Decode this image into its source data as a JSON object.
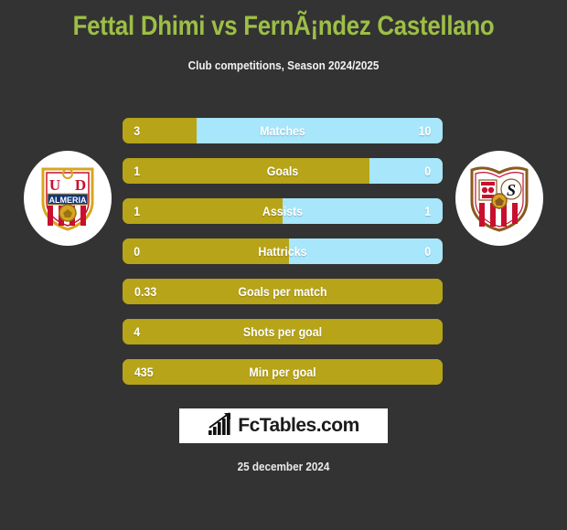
{
  "header": {
    "title": "Fettal Dhimi vs FernÃ¡ndez Castellano",
    "subtitle": "Club competitions, Season 2024/2025"
  },
  "teams": {
    "home": {
      "crest_name": "ud-almeria-crest",
      "crest_text": "UD ALMERIA"
    },
    "away": {
      "crest_name": "sevilla-fc-crest",
      "crest_text": "SEVILLA FC"
    }
  },
  "colors": {
    "background": "#333333",
    "title": "#9dbf46",
    "home_bar": "#b7a418",
    "away_bar": "#a7e6fb",
    "text": "#ffffff",
    "brand_bg": "#ffffff"
  },
  "chart_data": {
    "type": "bar",
    "title": "Fettal Dhimi vs FernÃ¡ndez Castellano",
    "subtitle": "Club competitions, Season 2024/2025",
    "orientation": "horizontal-diverging",
    "series": [
      {
        "name": "Fettal Dhimi",
        "color": "#b7a418"
      },
      {
        "name": "FernÃ¡ndez Castellano",
        "color": "#a7e6fb"
      }
    ],
    "categories": [
      "Matches",
      "Goals",
      "Assists",
      "Hattricks",
      "Goals per match",
      "Shots per goal",
      "Min per goal"
    ],
    "rows": [
      {
        "label": "Matches",
        "home": "3",
        "away": "10",
        "home_pct": 23,
        "away_pct": 77,
        "split": true
      },
      {
        "label": "Goals",
        "home": "1",
        "away": "0",
        "home_pct": 77,
        "away_pct": 23,
        "split": true
      },
      {
        "label": "Assists",
        "home": "1",
        "away": "1",
        "home_pct": 50,
        "away_pct": 50,
        "split": true
      },
      {
        "label": "Hattricks",
        "home": "0",
        "away": "0",
        "home_pct": 52,
        "away_pct": 48,
        "split": true
      },
      {
        "label": "Goals per match",
        "home": "0.33",
        "away": "",
        "home_pct": 100,
        "away_pct": 0,
        "split": false
      },
      {
        "label": "Shots per goal",
        "home": "4",
        "away": "",
        "home_pct": 100,
        "away_pct": 0,
        "split": false
      },
      {
        "label": "Min per goal",
        "home": "435",
        "away": "",
        "home_pct": 100,
        "away_pct": 0,
        "split": false
      }
    ]
  },
  "footer": {
    "brand": "FcTables.com",
    "brand_icon": "bar-chart-arrow-icon",
    "date": "25 december 2024"
  }
}
